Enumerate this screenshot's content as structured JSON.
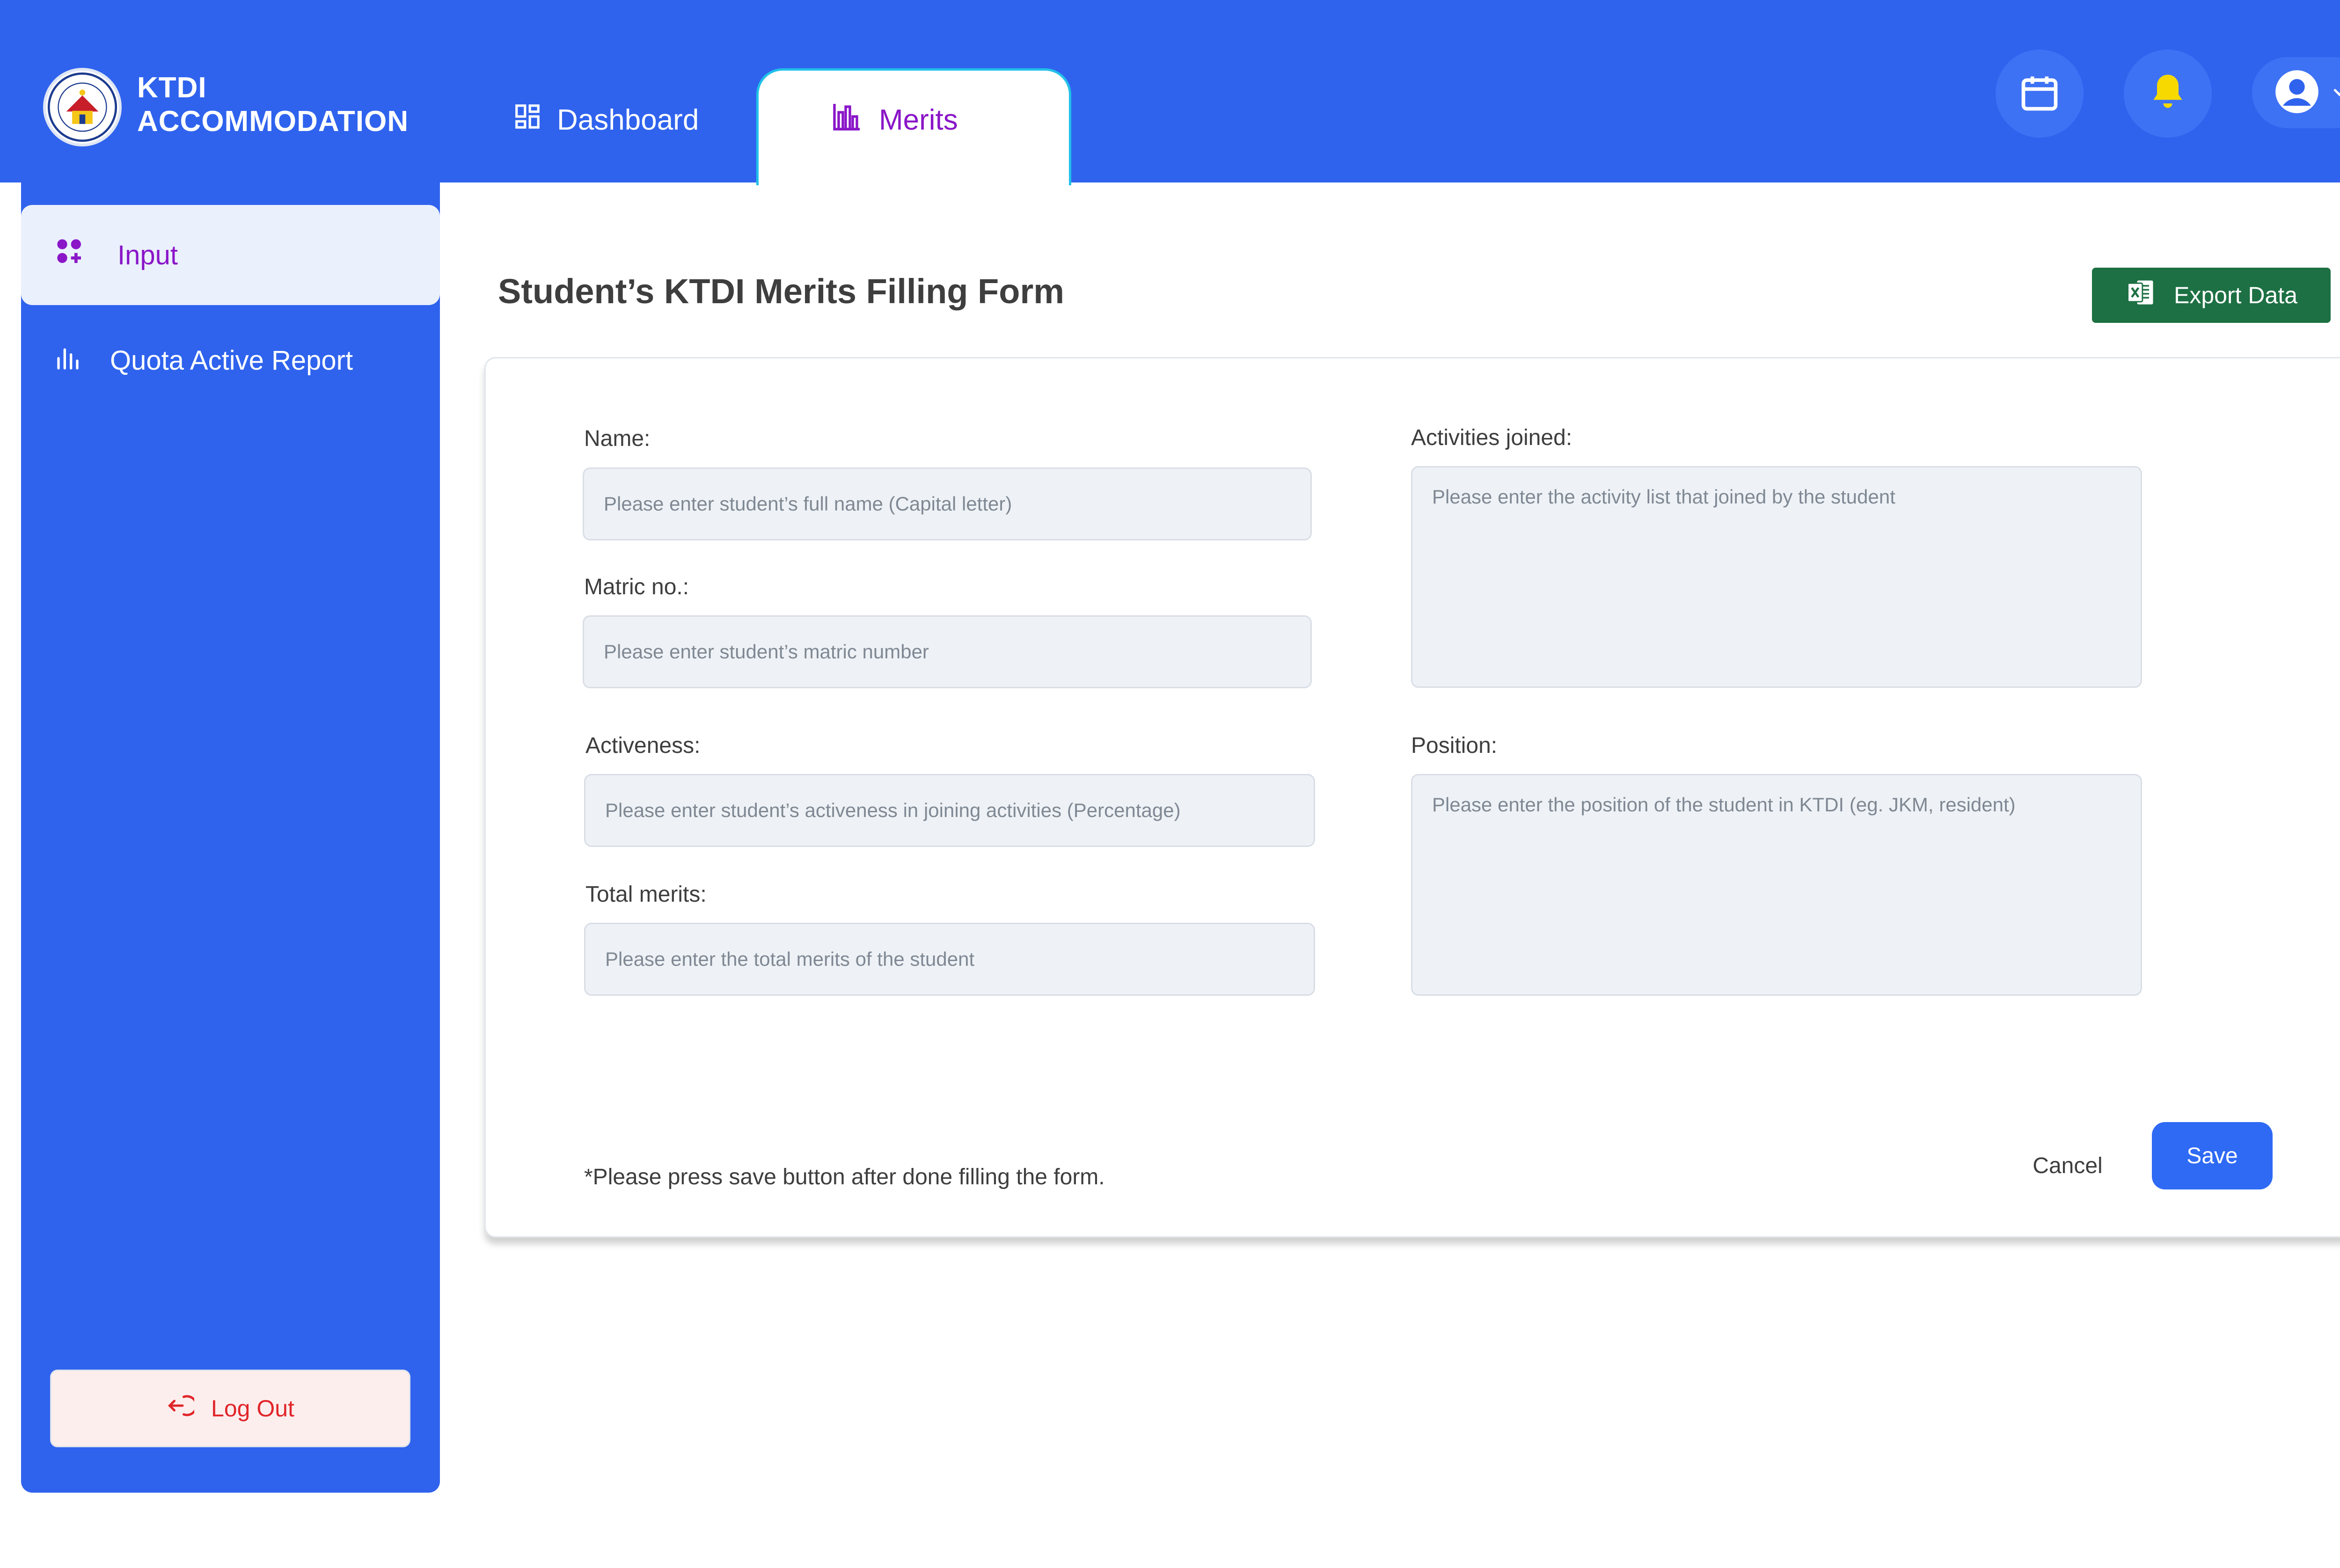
{
  "app": {
    "brand_line1": "KTDI",
    "brand_line2": "ACCOMMODATION"
  },
  "nav": {
    "dashboard_label": "Dashboard",
    "merits_label": "Merits",
    "active_tab": "Merits"
  },
  "header_icons": [
    "calendar-icon",
    "bell-icon",
    "avatar-icon",
    "chevron-down-icon"
  ],
  "sidebar": {
    "items": [
      {
        "label": "Input",
        "icon": "apps-icon",
        "active": true
      },
      {
        "label": "Quota Active Report",
        "icon": "bar-chart-icon",
        "active": false
      }
    ],
    "logout_label": "Log Out"
  },
  "form": {
    "title": "Student’s KTDI Merits Filling Form",
    "export_label": "Export Data",
    "fields": {
      "name": {
        "label": "Name:",
        "placeholder": "Please enter student’s full name (Capital letter)"
      },
      "matric": {
        "label": "Matric no.:",
        "placeholder": "Please enter student’s matric number"
      },
      "activeness": {
        "label": "Activeness:",
        "placeholder": "Please enter student’s activeness in joining activities (Percentage)"
      },
      "total_merits": {
        "label": "Total merits:",
        "placeholder": "Please enter the total merits of the student"
      },
      "activities": {
        "label": "Activities joined:",
        "placeholder": "Please enter the activity list that joined by the student"
      },
      "position": {
        "label": "Position:",
        "placeholder": "Please enter the position of the student in KTDI (eg. JKM, resident)"
      }
    },
    "note": "*Please press save button after done filling the form.",
    "cancel_label": "Cancel",
    "save_label": "Save"
  },
  "colors": {
    "primary_blue": "#2f63ee",
    "active_purple": "#8a16c8",
    "export_green": "#1d7043",
    "logout_red": "#e0262a",
    "bell_yellow": "#f7d900"
  }
}
